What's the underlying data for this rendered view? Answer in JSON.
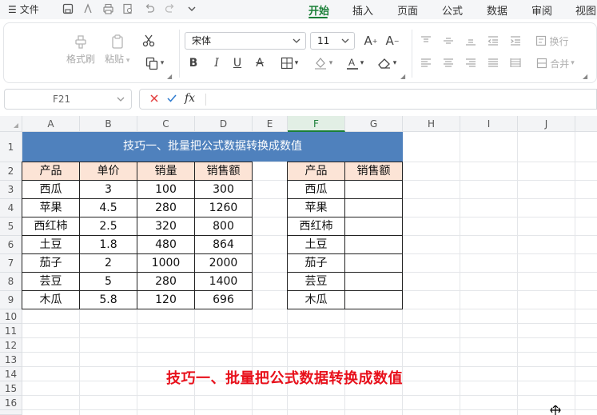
{
  "menubar": {
    "file_label": "文件",
    "tabs": [
      "开始",
      "插入",
      "页面",
      "公式",
      "数据",
      "审阅",
      "视图"
    ],
    "active_tab": "开始"
  },
  "ribbon": {
    "format_painter": "格式刷",
    "paste": "粘贴",
    "font_name": "宋体",
    "font_size": "11",
    "wrap_text": "换行",
    "merge": "合并"
  },
  "formula_bar": {
    "cell_ref": "F21",
    "formula_value": ""
  },
  "sheet": {
    "columns": [
      "A",
      "B",
      "C",
      "D",
      "E",
      "F",
      "G",
      "H",
      "I",
      "J"
    ],
    "selected_column": "F",
    "rows": [
      "1",
      "2",
      "3",
      "4",
      "5",
      "6",
      "7",
      "8",
      "9",
      "10",
      "11",
      "12",
      "13",
      "14",
      "15",
      "16"
    ],
    "banner": "技巧一、批量把公式数据转换成数值",
    "left_table": {
      "headers": [
        "产品",
        "单价",
        "销量",
        "销售额"
      ],
      "rows": [
        [
          "西瓜",
          "3",
          "100",
          "300"
        ],
        [
          "苹果",
          "4.5",
          "280",
          "1260"
        ],
        [
          "西红柿",
          "2.5",
          "320",
          "800"
        ],
        [
          "土豆",
          "1.8",
          "480",
          "864"
        ],
        [
          "茄子",
          "2",
          "1000",
          "2000"
        ],
        [
          "芸豆",
          "5",
          "280",
          "1400"
        ],
        [
          "木瓜",
          "5.8",
          "120",
          "696"
        ]
      ]
    },
    "right_table": {
      "headers": [
        "产品",
        "销售额"
      ],
      "rows": [
        [
          "西瓜",
          ""
        ],
        [
          "苹果",
          ""
        ],
        [
          "西红柿",
          ""
        ],
        [
          "土豆",
          ""
        ],
        [
          "茄子",
          ""
        ],
        [
          "芸豆",
          ""
        ],
        [
          "木瓜",
          ""
        ]
      ]
    },
    "overlay_title": "技巧一、批量把公式数据转换成数值"
  },
  "colors": {
    "accent": "#1a7f37",
    "banner_bg": "#4f81bd",
    "header_fill": "#fce4d6",
    "overlay_title": "#e8101b"
  }
}
